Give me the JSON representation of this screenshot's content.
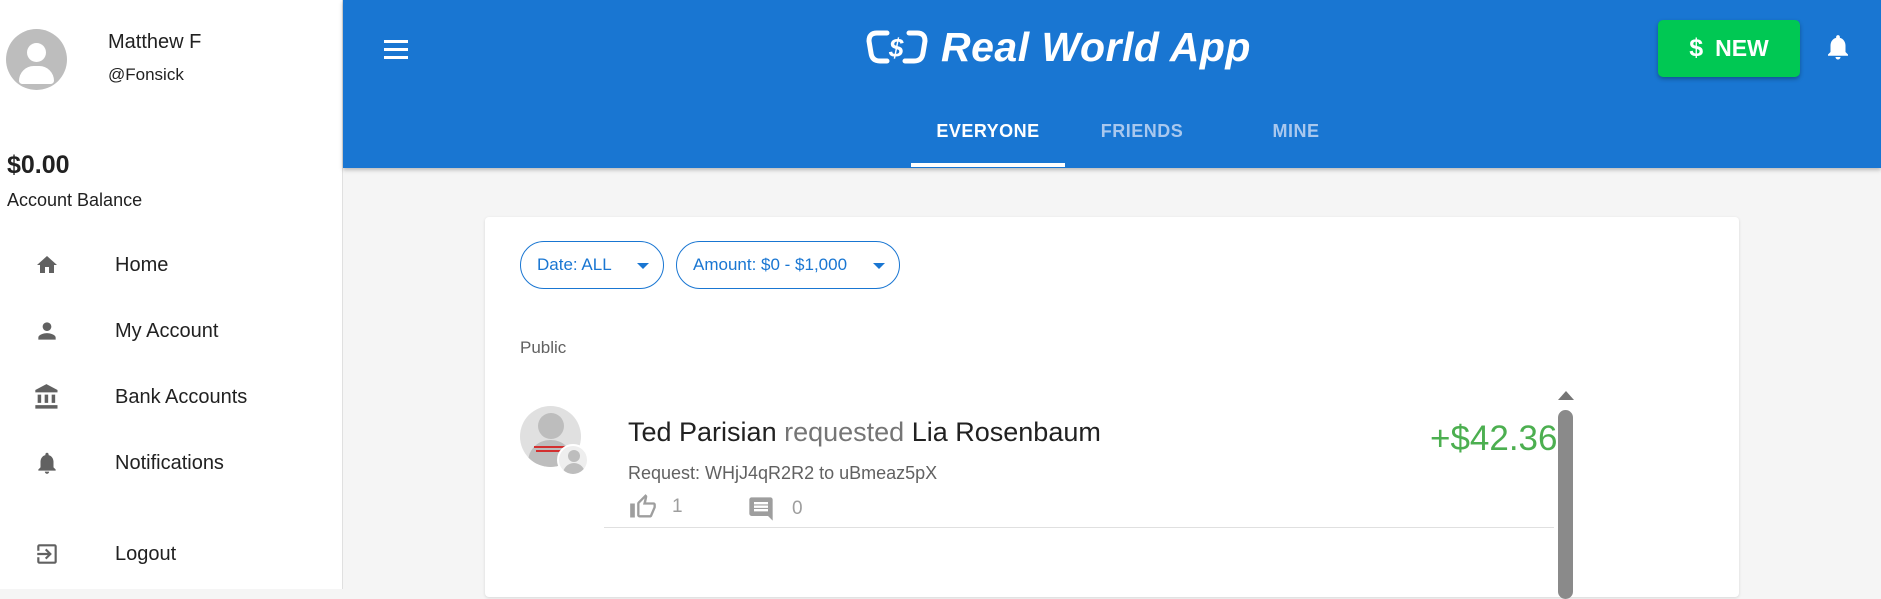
{
  "sidebar": {
    "user": {
      "name": "Matthew F",
      "handle": "@Fonsick"
    },
    "balance": {
      "amount": "$0.00",
      "label": "Account Balance"
    },
    "items": [
      {
        "label": "Home",
        "icon": "home-icon"
      },
      {
        "label": "My Account",
        "icon": "person-icon"
      },
      {
        "label": "Bank Accounts",
        "icon": "bank-icon"
      },
      {
        "label": "Notifications",
        "icon": "bell-icon"
      },
      {
        "label": "Logout",
        "icon": "logout-icon"
      }
    ]
  },
  "header": {
    "title": "Real World App",
    "new_label": "NEW",
    "new_symbol": "$",
    "tabs": [
      {
        "label": "EVERYONE",
        "active": true
      },
      {
        "label": "FRIENDS",
        "active": false
      },
      {
        "label": "MINE",
        "active": false
      }
    ]
  },
  "filters": {
    "date": "Date: ALL",
    "amount": "Amount: $0 - $1,000"
  },
  "feed": {
    "section": "Public",
    "transactions": [
      {
        "sender": "Ted Parisian",
        "verb": "requested",
        "receiver": "Lia Rosenbaum",
        "detail": "Request: WHjJ4qR2R2 to uBmeaz5pX",
        "amount": "+$42.36",
        "likes": "1",
        "comments": "0"
      }
    ]
  },
  "colors": {
    "header": "#1976d2",
    "new_button": "#00c853",
    "amount_positive": "#4caf50"
  }
}
